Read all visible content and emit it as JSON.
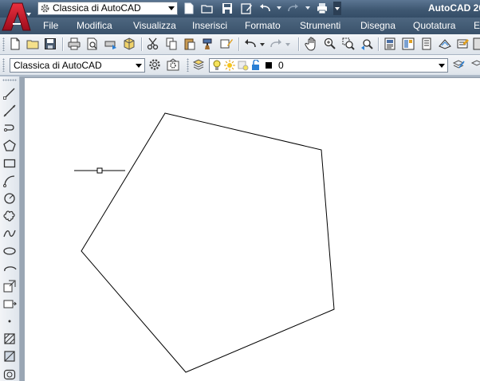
{
  "app": {
    "title": "AutoCAD 20"
  },
  "quick_access": {
    "workspace_value": "Classica di AutoCAD"
  },
  "menu": {
    "items": [
      "File",
      "Modifica",
      "Visualizza",
      "Inserisci",
      "Formato",
      "Strumenti",
      "Disegna",
      "Quotatura",
      "E"
    ]
  },
  "workspaces_toolbar": {
    "workspace_value": "Classica di AutoCAD"
  },
  "layer_toolbar": {
    "current_layer": "0",
    "layer_color": "#000000"
  },
  "icons": {
    "app_button": "autocad-logo-icon",
    "gear": "gear-icon",
    "new": "new-file-icon",
    "open": "open-folder-icon",
    "save": "save-icon",
    "undo": "undo-icon",
    "redo": "redo-icon",
    "plot": "print-icon"
  },
  "colors": {
    "title_bar": "#3f5872",
    "menu_bar": "#3a526b",
    "canvas": "#ffffff",
    "app_logo_red": "#c8102e"
  }
}
